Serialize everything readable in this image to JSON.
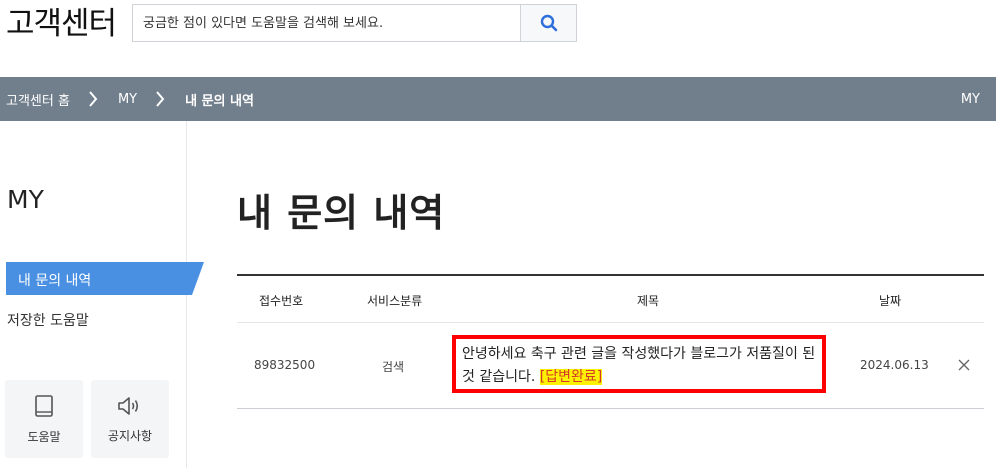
{
  "header": {
    "brand": "고객센터",
    "search_placeholder": "궁금한 점이 있다면 도움말을 검색해 보세요."
  },
  "breadcrumb": {
    "items": [
      "고객센터 홈",
      "MY",
      "내 문의 내역"
    ],
    "right_label": "MY"
  },
  "sidebar": {
    "title": "MY",
    "items": [
      {
        "label": "내 문의 내역",
        "active": true
      },
      {
        "label": "저장한 도움말",
        "active": false
      }
    ],
    "cards": [
      {
        "label": "도움말",
        "icon": "book-icon"
      },
      {
        "label": "공지사항",
        "icon": "speaker-icon"
      }
    ]
  },
  "main": {
    "title": "내 문의 내역",
    "table": {
      "headers": [
        "접수번호",
        "서비스분류",
        "제목",
        "날짜"
      ],
      "rows": [
        {
          "id": "89832500",
          "category": "검색",
          "subject": "안녕하세요 축구 관련 글을 작성했다가 블로그가 저품질이 된 것 같습니다.",
          "status": "[답변완료]",
          "date": "2024.06.13"
        }
      ]
    }
  },
  "colors": {
    "navbar": "#717e8c",
    "active_item": "#4a90e2",
    "highlight_border": "#ff0000",
    "status_bg": "#fff200",
    "status_text": "#d43a2a"
  }
}
